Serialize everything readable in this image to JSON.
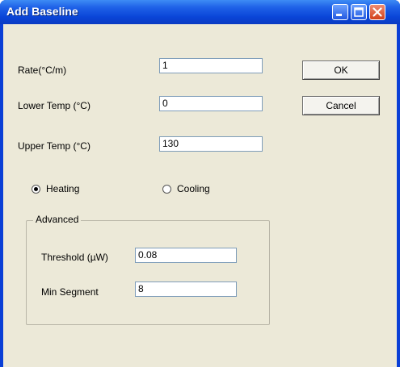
{
  "window": {
    "title": "Add Baseline",
    "controls": [
      "minimize-icon",
      "maximize-icon",
      "close-icon"
    ]
  },
  "form": {
    "rate": {
      "label": "Rate(°C/m)",
      "value": "1"
    },
    "lower_temp": {
      "label": "Lower Temp (°C)",
      "value": "0"
    },
    "upper_temp": {
      "label": "Upper Temp (°C)",
      "value": "130"
    },
    "mode": {
      "heating_label": "Heating",
      "cooling_label": "Cooling",
      "selected": "Heating"
    }
  },
  "advanced": {
    "title": "Advanced",
    "threshold": {
      "label": "Threshold (µW)",
      "value": "0.08"
    },
    "min_segment": {
      "label": "Min Segment",
      "value": "8"
    }
  },
  "buttons": {
    "ok": "OK",
    "cancel": "Cancel"
  },
  "colors": {
    "titlebar": "#0a45d8",
    "client_background": "#ece9d8",
    "close_button": "#d2411b"
  }
}
